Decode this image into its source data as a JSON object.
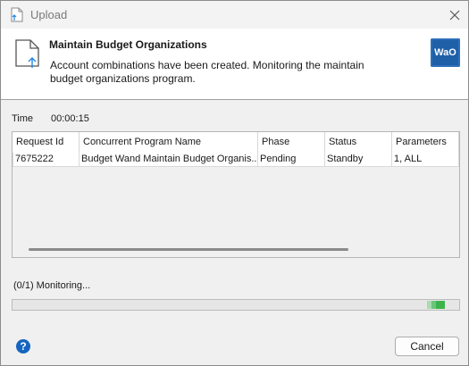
{
  "window": {
    "title": "Upload"
  },
  "header": {
    "title": "Maintain Budget Organizations",
    "description": "Account combinations have been created. Monitoring the maintain budget organizations program.",
    "logo_text": "WaO",
    "logo_color": "#1e5fa8"
  },
  "time": {
    "label": "Time",
    "value": "00:00:15"
  },
  "grid": {
    "columns": [
      "Request Id",
      "Concurrent Program Name",
      "Phase",
      "Status",
      "Parameters"
    ],
    "rows": [
      [
        "7675222",
        "Budget Wand Maintain Budget Organis...",
        "Pending",
        "Standby",
        "1, ALL"
      ]
    ]
  },
  "monitor": {
    "status_text": "(0/1) Monitoring...",
    "progress_accent": "#3cb44b"
  },
  "footer": {
    "cancel_label": "Cancel",
    "help_icon": "question-circle-icon",
    "help_glyph": "?"
  }
}
